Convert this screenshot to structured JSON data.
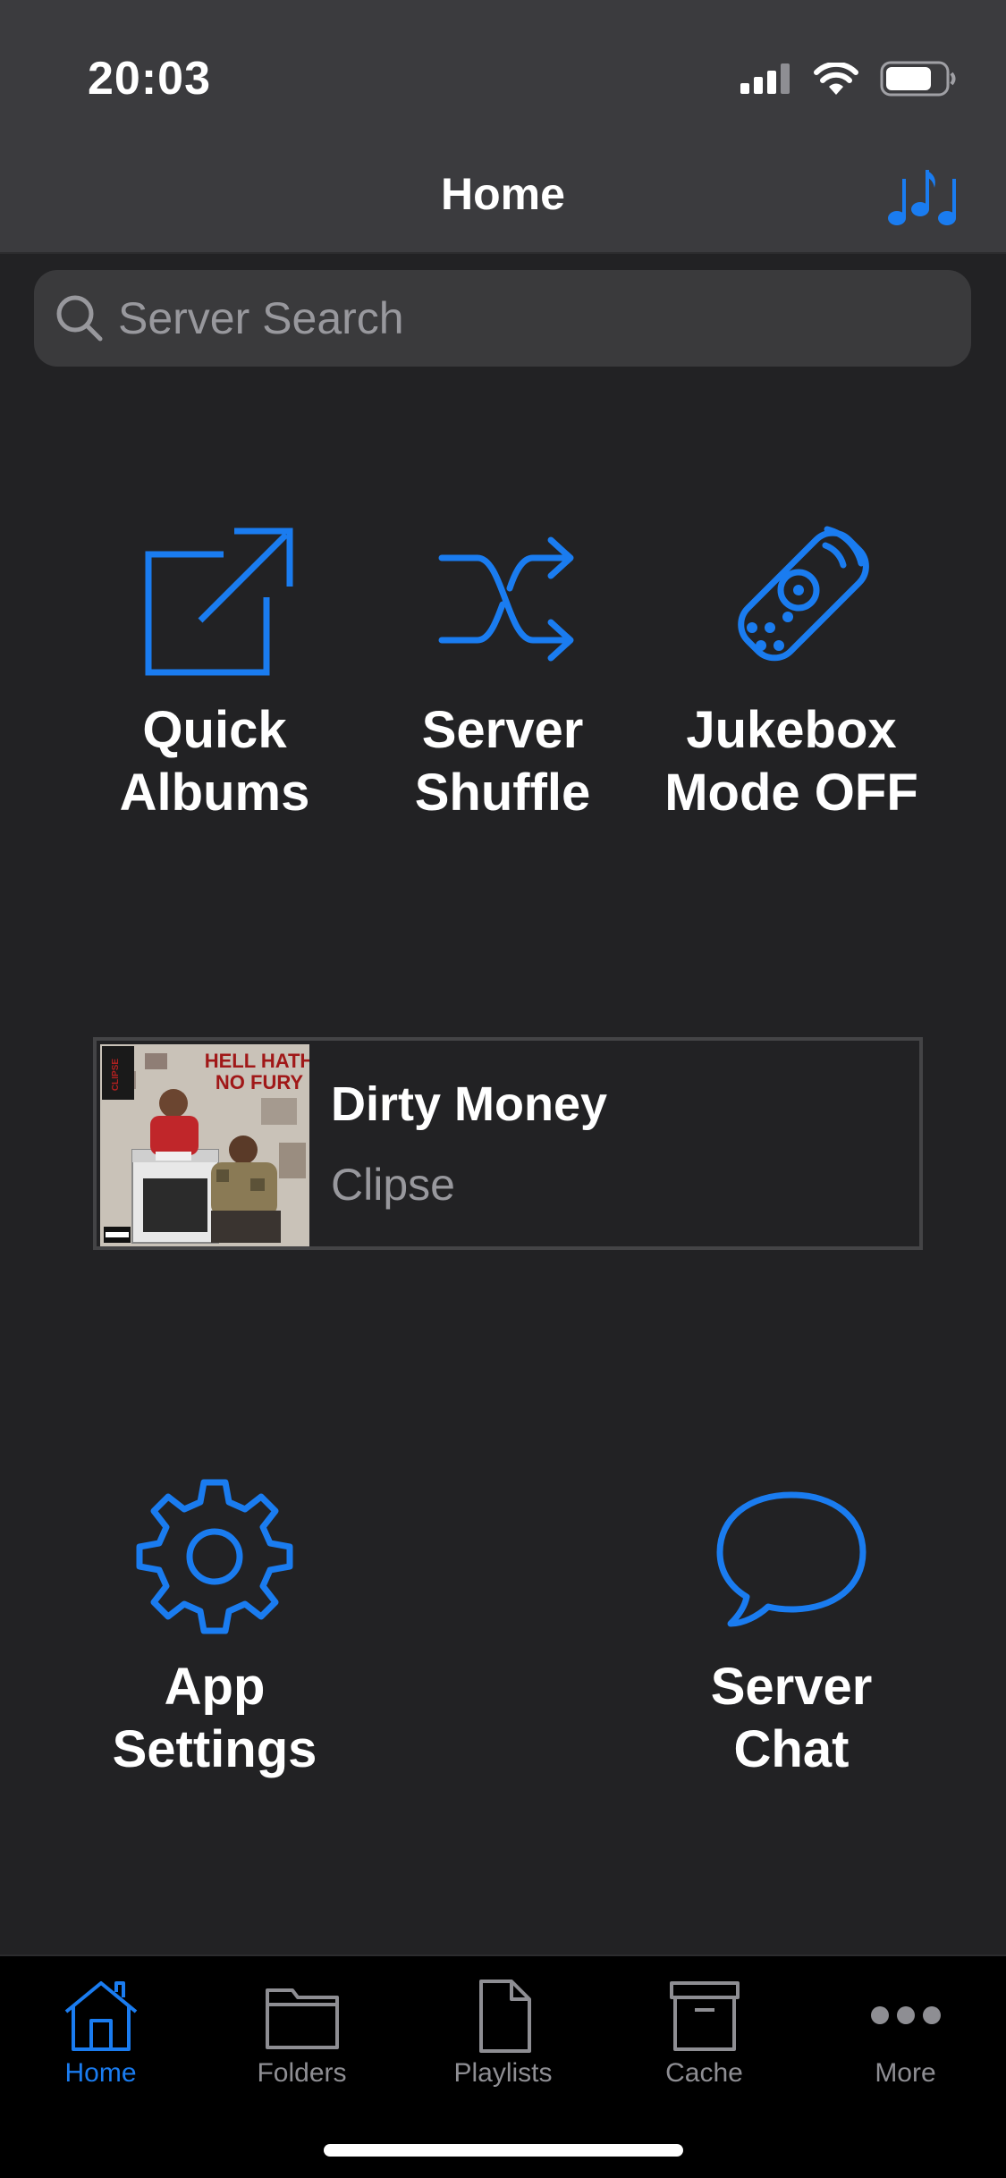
{
  "colors": {
    "accent": "#1a7cf0",
    "background": "#222224",
    "bar": "#3b3b3e",
    "tab_inactive": "#8e8e93"
  },
  "status_bar": {
    "time": "20:03",
    "icons": [
      "cellular-signal-icon",
      "wifi-icon",
      "battery-icon"
    ]
  },
  "nav": {
    "title": "Home",
    "right_button_icon": "music-notes-icon"
  },
  "search": {
    "placeholder": "Server Search",
    "value": ""
  },
  "home_buttons": {
    "quick_albums": {
      "label": "Quick\nAlbums",
      "icon": "external-link-icon"
    },
    "server_shuffle": {
      "label": "Server\nShuffle",
      "icon": "shuffle-icon"
    },
    "jukebox": {
      "label": "Jukebox\nMode OFF",
      "icon": "remote-control-icon"
    },
    "app_settings": {
      "label": "App\nSettings",
      "icon": "gear-icon"
    },
    "server_chat": {
      "label": "Server\nChat",
      "icon": "chat-bubble-icon"
    }
  },
  "now_playing": {
    "title": "Dirty Money",
    "artist": "Clipse",
    "art_text": [
      "CLIPSE",
      "HELL HATH",
      "NO FURY"
    ]
  },
  "tab_bar": {
    "selected": "home",
    "tabs": [
      {
        "id": "home",
        "label": "Home",
        "icon": "house-icon"
      },
      {
        "id": "folders",
        "label": "Folders",
        "icon": "folder-icon"
      },
      {
        "id": "playlists",
        "label": "Playlists",
        "icon": "document-icon"
      },
      {
        "id": "cache",
        "label": "Cache",
        "icon": "archive-box-icon"
      },
      {
        "id": "more",
        "label": "More",
        "icon": "ellipsis-icon"
      }
    ]
  }
}
